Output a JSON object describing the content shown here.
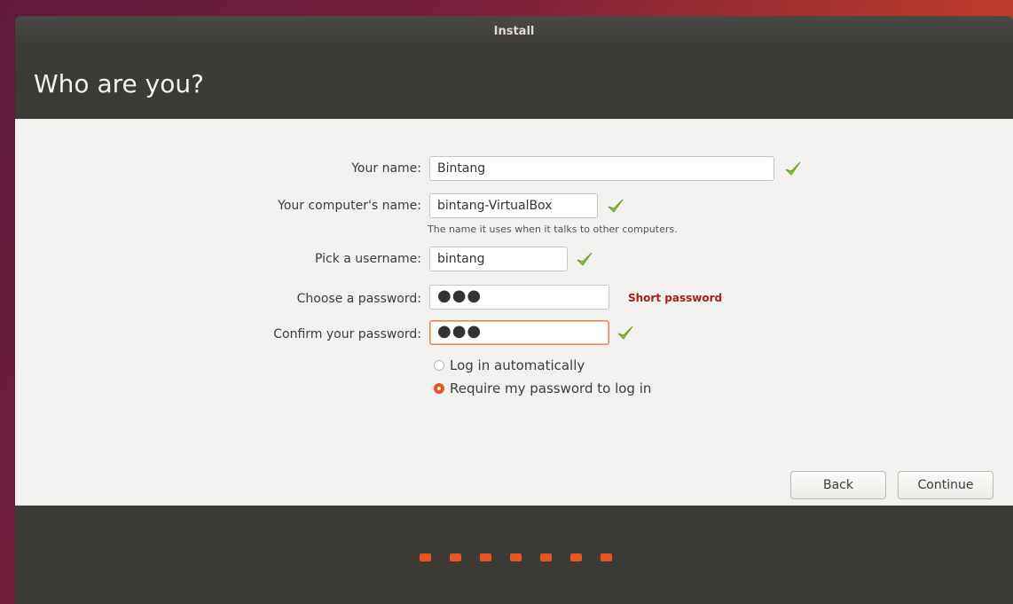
{
  "window": {
    "title": "Install"
  },
  "page": {
    "title": "Who are you?"
  },
  "form": {
    "name": {
      "label": "Your name:",
      "value": "Bintang"
    },
    "computer_name": {
      "label": "Your computer's name:",
      "value": "bintang-VirtualBox",
      "hint": "The name it uses when it talks to other computers."
    },
    "username": {
      "label": "Pick a username:",
      "value": "bintang"
    },
    "password": {
      "label": "Choose a password:",
      "value": "●●●",
      "strength": "Short password"
    },
    "confirm_password": {
      "label": "Confirm your password:",
      "value": "●●●"
    },
    "login_options": [
      {
        "label": "Log in automatically",
        "selected": false
      },
      {
        "label": "Require my password to log in",
        "selected": true
      }
    ]
  },
  "buttons": {
    "back": "Back",
    "continue": "Continue"
  },
  "progress": {
    "total_steps": 7
  },
  "icons": {
    "valid": "check-icon"
  },
  "colors": {
    "accent": "#e95420",
    "check": "#8cc63f",
    "warning": "#a51d1d"
  }
}
